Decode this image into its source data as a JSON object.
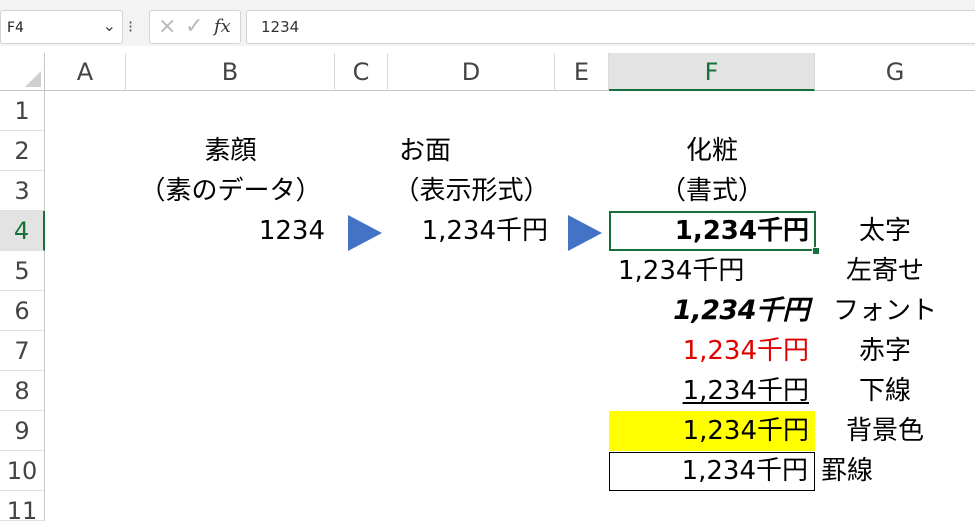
{
  "formula_bar": {
    "name_box": "F4",
    "name_box_arrow": "⌄",
    "more": "⁝",
    "cancel": "×",
    "enter": "✓",
    "fx": "fx",
    "formula": "1234"
  },
  "columns": [
    "A",
    "B",
    "C",
    "D",
    "E",
    "F",
    "G"
  ],
  "rows": [
    "1",
    "2",
    "3",
    "4",
    "5",
    "6",
    "7",
    "8",
    "9",
    "10",
    "11"
  ],
  "selected_cell": {
    "column": "F",
    "row": "4"
  },
  "cells": {
    "B2": "素顔",
    "B3": "（素のデータ）",
    "B4": "1234",
    "D2": "お面",
    "D3": "（表示形式）",
    "D4": "1,234千円",
    "F2": "化粧",
    "F3": "（書式）",
    "F4": "1,234千円",
    "F5": "1,234千円",
    "F6": "1,234千円",
    "F7": "1,234千円",
    "F8": "1,234千円",
    "F9": "1,234千円",
    "F10": "1,234千円",
    "G4": "太字",
    "G5": "左寄せ",
    "G6": "フォント",
    "G7": "赤字",
    "G8": "下線",
    "G9": "背景色",
    "G10": "罫線"
  },
  "colors": {
    "accent": "#17703a",
    "arrow": "#4472c4",
    "red_text": "#e00000",
    "highlight": "#ffff00"
  }
}
